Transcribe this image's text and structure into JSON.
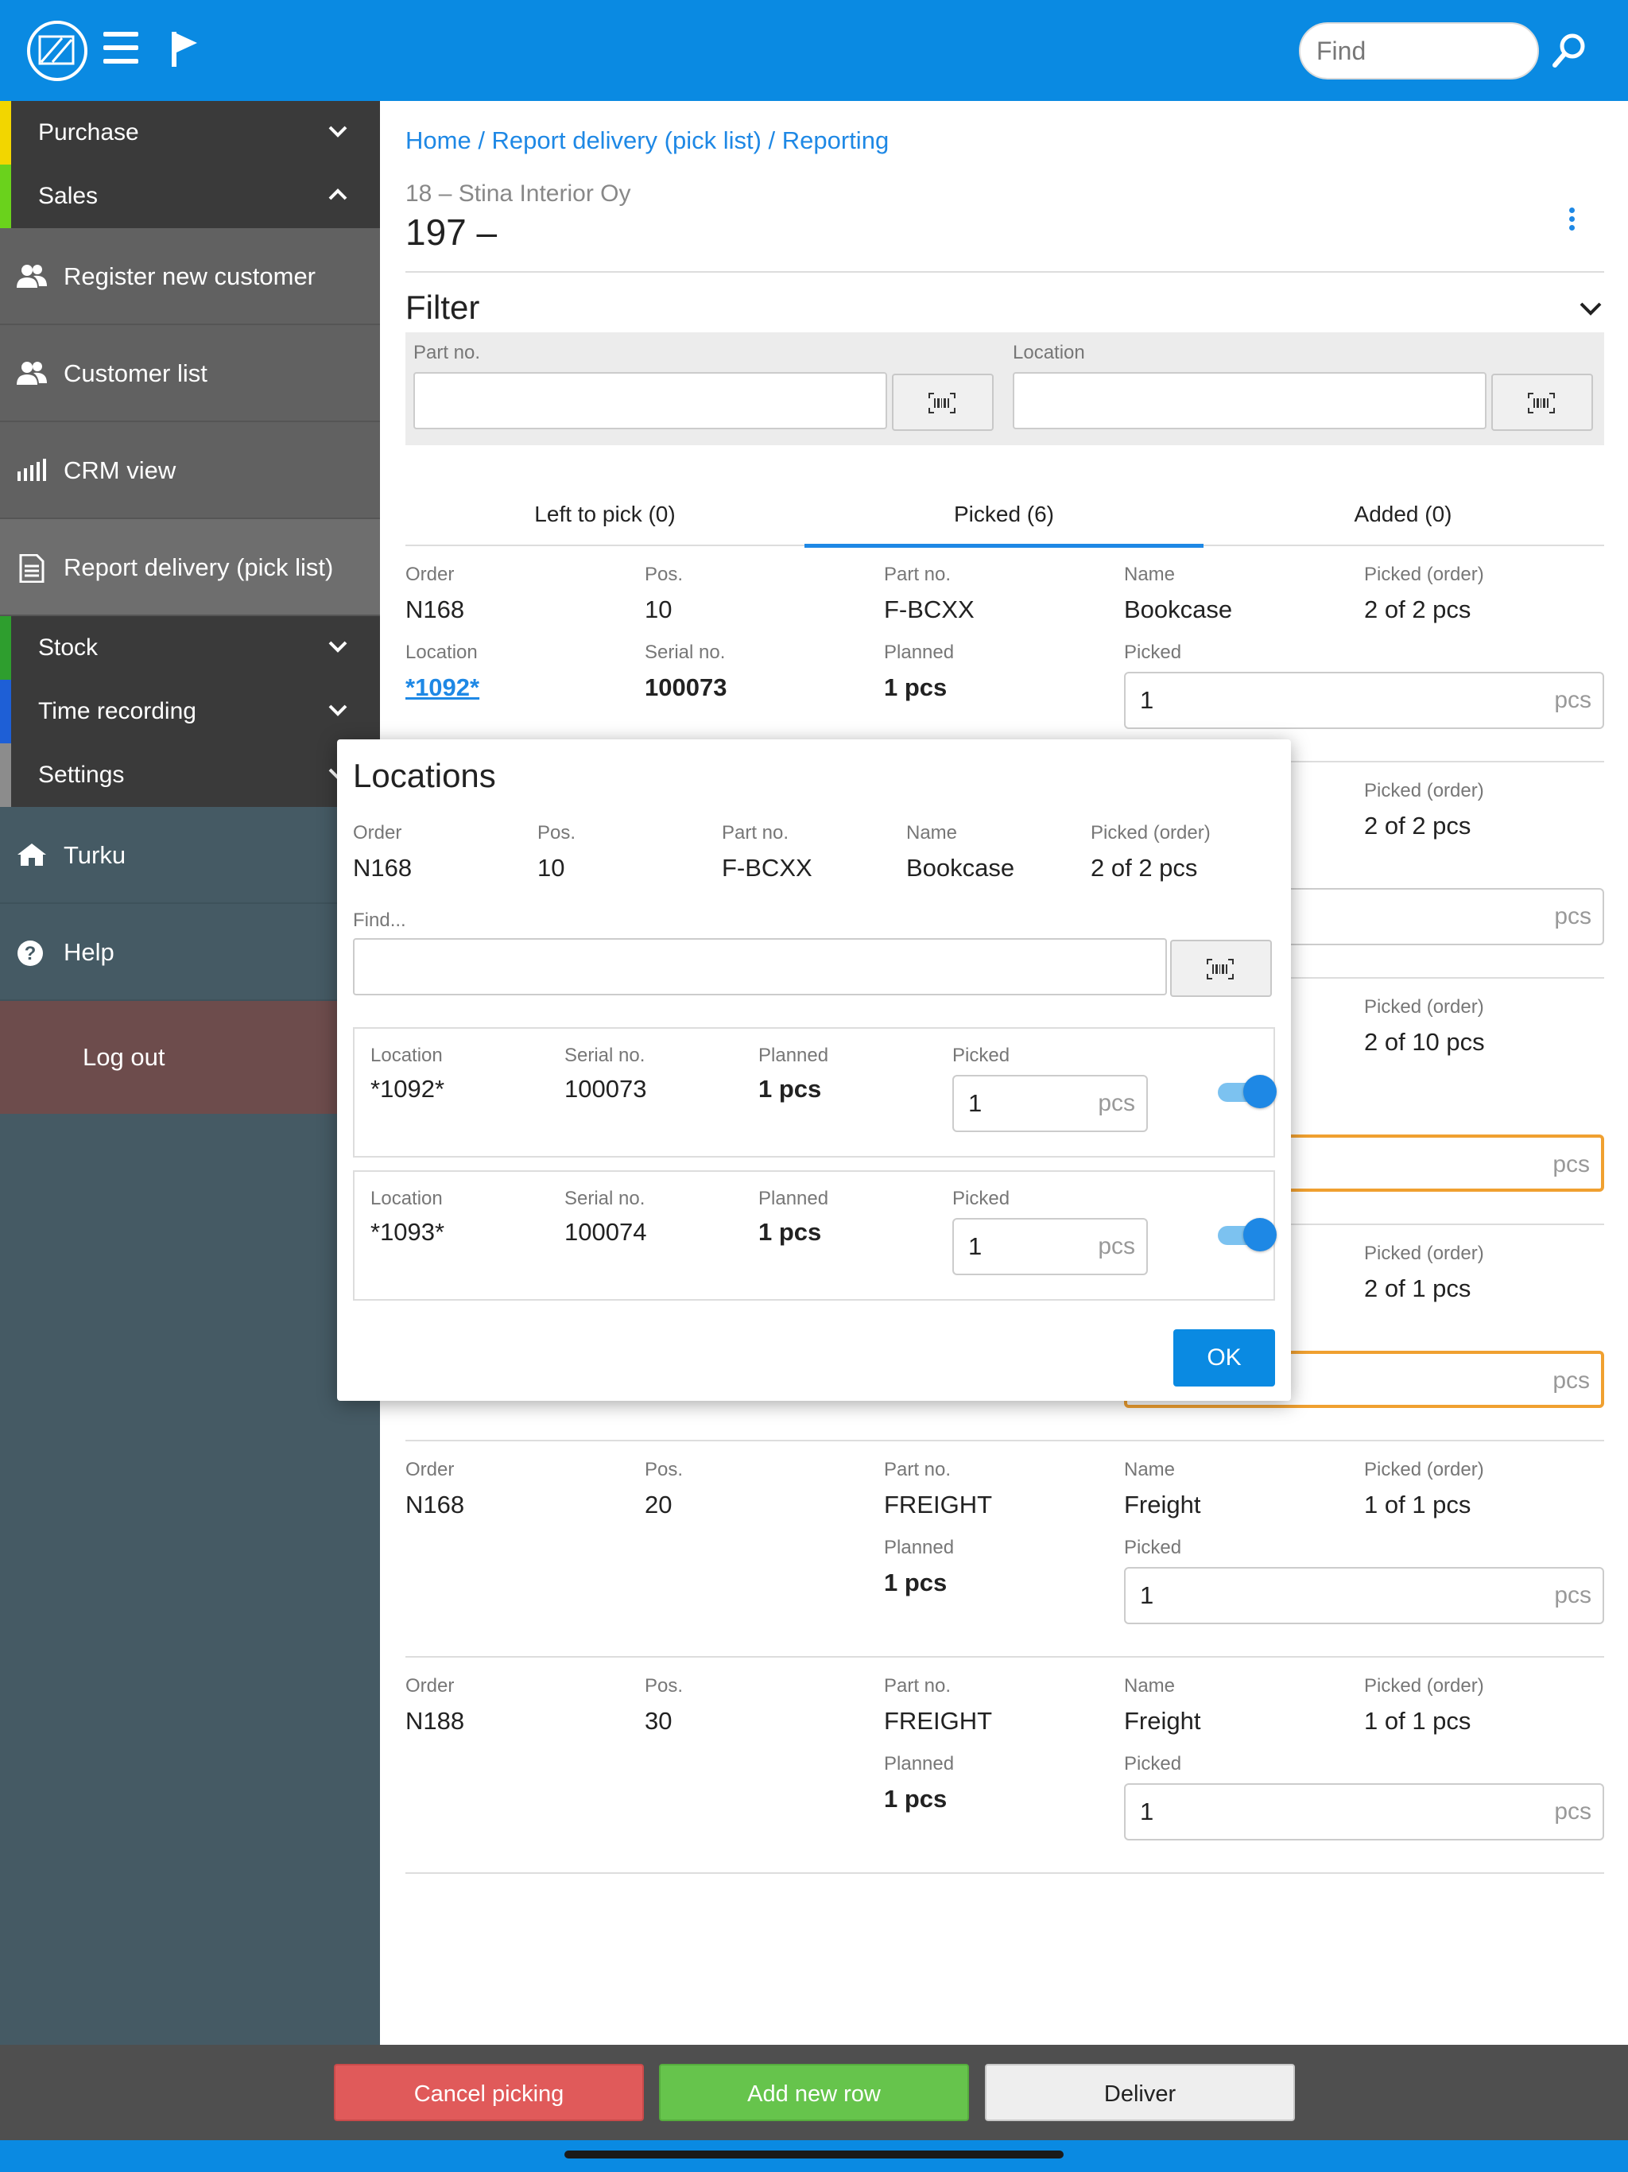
{
  "topbar": {
    "search_placeholder": "Find"
  },
  "sidebar": {
    "purchase": "Purchase",
    "sales": "Sales",
    "register_new_customer": "Register new customer",
    "customer_list": "Customer list",
    "crm_view": "CRM view",
    "report_delivery": "Report delivery (pick list)",
    "stock": "Stock",
    "time_recording": "Time recording",
    "settings": "Settings",
    "location": "Turku",
    "help": "Help",
    "logout": "Log out",
    "colors": {
      "purchase": "#f2d600",
      "sales": "#6ad21c",
      "stock": "#2e9e2e",
      "time_recording": "#1e5fd6",
      "settings": "#8c8c8c"
    }
  },
  "header": {
    "breadcrumb": [
      "Home",
      "Report delivery (pick list)",
      "Reporting"
    ],
    "customer": "18 – Stina Interior Oy",
    "doc_number": "197 –"
  },
  "filter": {
    "title": "Filter",
    "part_no_label": "Part no.",
    "location_label": "Location"
  },
  "tabs": [
    "Left to pick (0)",
    "Picked (6)",
    "Added (0)"
  ],
  "labels": {
    "order": "Order",
    "pos": "Pos.",
    "part_no": "Part no.",
    "name": "Name",
    "picked_order": "Picked (order)",
    "location": "Location",
    "serial_no": "Serial no.",
    "planned": "Planned",
    "picked": "Picked",
    "unit": "pcs"
  },
  "rows": [
    {
      "order": "N168",
      "pos": "10",
      "part_no": "F-BCXX",
      "name": "Bookcase",
      "picked_order": "2 of 2 pcs",
      "location": "*1092*",
      "serial_no": "100073",
      "planned": "1 pcs",
      "picked": "1"
    },
    {
      "picked_order": "2 of 2 pcs"
    },
    {
      "picked_order": "2 of 10 pcs"
    },
    {
      "picked_order": "2 of 1 pcs"
    },
    {
      "order": "N168",
      "pos": "20",
      "part_no": "FREIGHT",
      "name": "Freight",
      "picked_order": "1 of 1 pcs",
      "planned": "1 pcs",
      "picked": "1"
    },
    {
      "order": "N188",
      "pos": "30",
      "part_no": "FREIGHT",
      "name": "Freight",
      "picked_order": "1 of 1 pcs",
      "planned": "1 pcs",
      "picked": "1"
    }
  ],
  "modal": {
    "title": "Locations",
    "order": "N168",
    "pos": "10",
    "part_no": "F-BCXX",
    "name": "Bookcase",
    "picked_order": "2 of 2 pcs",
    "find_label": "Find...",
    "items": [
      {
        "location": "*1092*",
        "serial_no": "100073",
        "planned": "1 pcs",
        "picked": "1",
        "enabled": true
      },
      {
        "location": "*1093*",
        "serial_no": "100074",
        "planned": "1 pcs",
        "picked": "1",
        "enabled": true
      }
    ],
    "ok": "OK"
  },
  "bottombar": {
    "cancel": "Cancel picking",
    "add": "Add new row",
    "deliver": "Deliver"
  }
}
